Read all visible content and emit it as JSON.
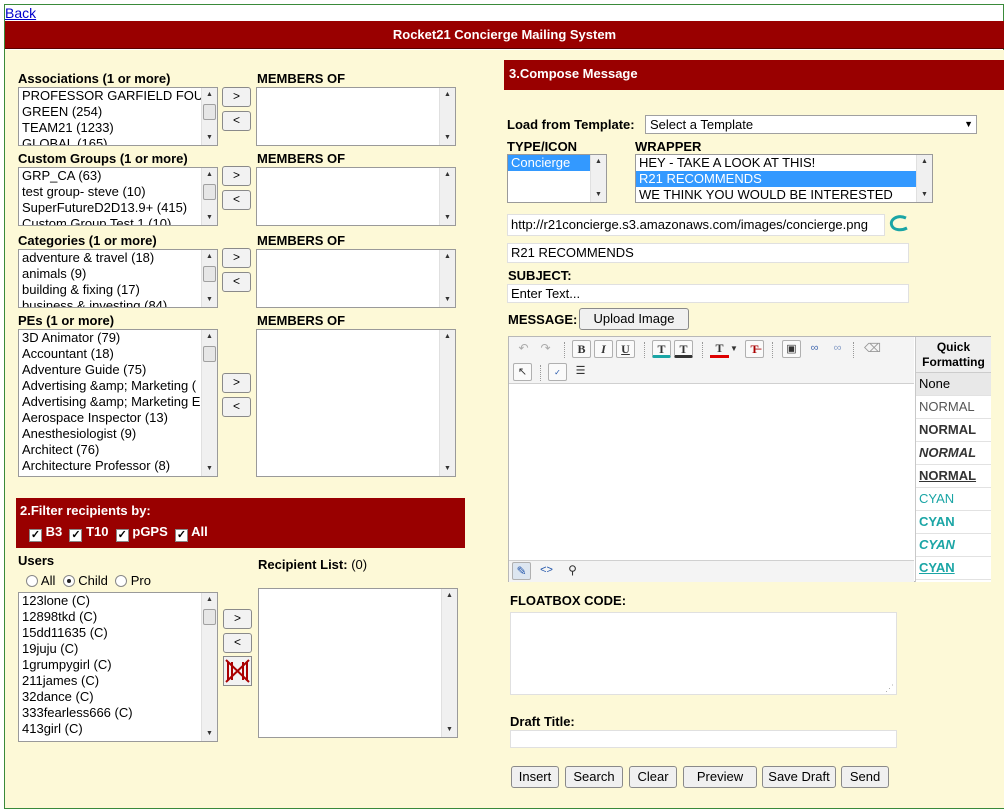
{
  "back_link": "Back",
  "title": "Rocket21 Concierge Mailing System",
  "left": {
    "groups": [
      {
        "label": "Associations (1 or more)",
        "members_label": "MEMBERS OF",
        "items": [
          "PROFESSOR GARFIELD FOU",
          "GREEN (254)",
          "TEAM21 (1233)",
          "GLOBAL (165)"
        ]
      },
      {
        "label": "Custom Groups (1 or more)",
        "members_label": "MEMBERS OF",
        "items": [
          "GRP_CA (63)",
          "test group- steve (10)",
          "SuperFutureD2D13.9+ (415)",
          "Custom Group Test 1 (10)"
        ]
      },
      {
        "label": "Categories (1 or more)",
        "members_label": "MEMBERS OF",
        "items": [
          "adventure & travel (18)",
          "animals (9)",
          "building & fixing (17)",
          "business & investing (84)"
        ]
      },
      {
        "label": "PEs (1 or more)",
        "members_label": "MEMBERS OF",
        "items": [
          "3D Animator (79)",
          "Accountant (18)",
          "Adventure Guide (75)",
          "Advertising &amp; Marketing (",
          "Advertising &amp; Marketing E",
          "Aerospace Inspector (13)",
          "Anesthesiologist (9)",
          "Architect (76)",
          "Architecture Professor (8)"
        ]
      }
    ],
    "add_btn": ">",
    "remove_btn": "<",
    "filter": {
      "title": "2.Filter recipients by:",
      "options": [
        {
          "label": "B3",
          "checked": true
        },
        {
          "label": "T10",
          "checked": true
        },
        {
          "label": "pGPS",
          "checked": true
        },
        {
          "label": "All",
          "checked": true
        }
      ]
    },
    "users": {
      "label": "Users",
      "radios": [
        {
          "label": "All",
          "checked": false
        },
        {
          "label": "Child",
          "checked": true
        },
        {
          "label": "Pro",
          "checked": false
        }
      ],
      "items": [
        "123lone (C)",
        "12898tkd (C)",
        "15dd11635 (C)",
        "19juju (C)",
        "1grumpygirl (C)",
        "211james (C)",
        "32dance (C)",
        "333fearless666 (C)",
        "413girl (C)"
      ]
    },
    "recipient_list_label": "Recipient List:",
    "recipient_count": "(0)"
  },
  "compose": {
    "title": "3.Compose Message",
    "load_template_label": "Load from Template:",
    "template_select": "Select a Template",
    "type_icon_label": "TYPE/ICON",
    "type_items": [
      "Concierge"
    ],
    "wrapper_label": "WRAPPER",
    "wrapper_items": [
      "HEY - TAKE A LOOK AT THIS!",
      "R21 RECOMMENDS",
      "WE THINK YOU WOULD BE INTERESTED"
    ],
    "icon_url": "http://r21concierge.s3.amazonaws.com/images/concierge.png",
    "wrapper_value": "R21 RECOMMENDS",
    "subject_label": "SUBJECT:",
    "subject_placeholder": "Enter Text...",
    "message_label": "MESSAGE:",
    "upload_button": "Upload Image",
    "quick_formatting_title": "Quick Formatting",
    "quick_formatting": [
      "None",
      "NORMAL",
      "NORMAL",
      "NORMAL",
      "NORMAL",
      "CYAN",
      "CYAN",
      "CYAN",
      "CYAN"
    ],
    "floatbox_label": "FLOATBOX CODE:",
    "draft_title_label": "Draft Title:",
    "buttons": [
      "Insert",
      "Search",
      "Clear",
      "Preview",
      "Save Draft",
      "Send"
    ]
  },
  "colors": {
    "brand_red": "#990000",
    "panel_bg": "#fdf9d7",
    "cyan": "#1aa5a5",
    "selection": "#3399ff"
  }
}
